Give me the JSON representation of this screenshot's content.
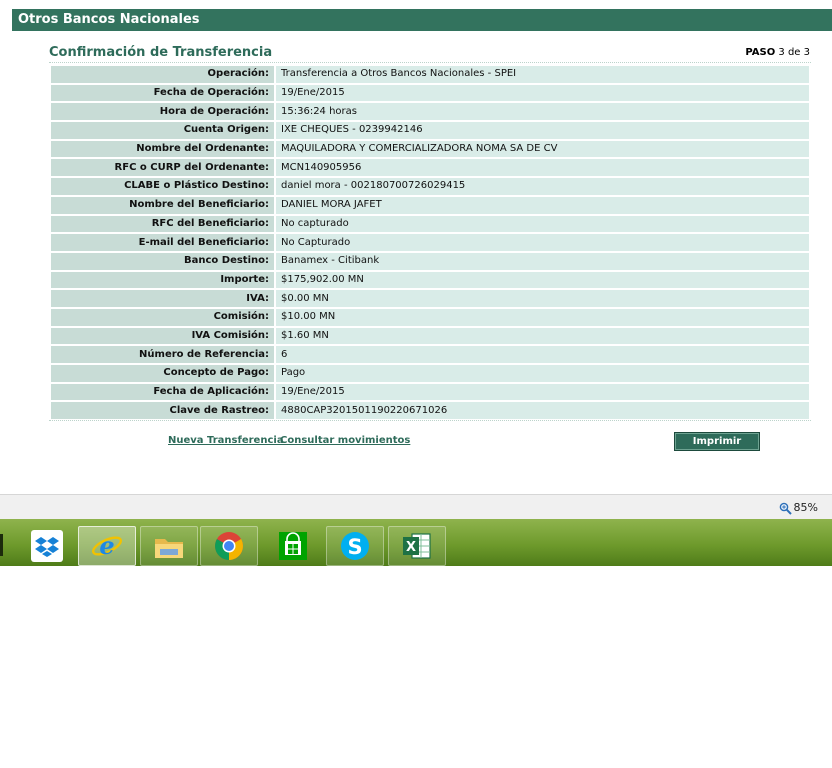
{
  "header": {
    "title": "Otros Bancos Nacionales"
  },
  "form": {
    "title": "Confirmación de Transferencia",
    "step_label": "PASO",
    "step_value": "3 de 3"
  },
  "details": [
    {
      "label": "Operación:",
      "value": "Transferencia a Otros Bancos Nacionales - SPEI"
    },
    {
      "label": "Fecha de Operación:",
      "value": "19/Ene/2015"
    },
    {
      "label": "Hora de Operación:",
      "value": "15:36:24 horas"
    },
    {
      "label": "Cuenta Origen:",
      "value": "IXE CHEQUES - 0239942146"
    },
    {
      "label": "Nombre del Ordenante:",
      "value": "MAQUILADORA Y COMERCIALIZADORA NOMA SA DE CV"
    },
    {
      "label": "RFC o CURP del Ordenante:",
      "value": "MCN140905956"
    },
    {
      "label": "CLABE o Plástico Destino:",
      "value": "daniel mora - 002180700726029415"
    },
    {
      "label": "Nombre del Beneficiario:",
      "value": "DANIEL MORA JAFET"
    },
    {
      "label": "RFC del Beneficiario:",
      "value": "No capturado"
    },
    {
      "label": "E-mail del Beneficiario:",
      "value": "No Capturado"
    },
    {
      "label": "Banco Destino:",
      "value": "Banamex - Citibank"
    },
    {
      "label": "Importe:",
      "value": "$175,902.00 MN"
    },
    {
      "label": "IVA:",
      "value": "$0.00 MN"
    },
    {
      "label": "Comisión:",
      "value": "$10.00 MN"
    },
    {
      "label": "IVA Comisión:",
      "value": "$1.60 MN"
    },
    {
      "label": "Número de Referencia:",
      "value": "6"
    },
    {
      "label": "Concepto de Pago:",
      "value": "Pago"
    },
    {
      "label": "Fecha de Aplicación:",
      "value": "19/Ene/2015"
    },
    {
      "label": "Clave de Rastreo:",
      "value": "4880CAP3201501190220671026"
    }
  ],
  "actions": {
    "new_transfer": "Nueva Transferencia",
    "view_movements": "Consultar movimientos",
    "print": "Imprimir"
  },
  "status_bar": {
    "zoom": "85%",
    "zoom_icon": "zoom-magnifier-icon"
  },
  "taskbar": {
    "apps": [
      {
        "name": "dropbox",
        "icon": "dropbox-icon"
      },
      {
        "name": "internet-explorer",
        "icon": "internet-explorer-icon",
        "active": true
      },
      {
        "name": "file-explorer",
        "icon": "folder-icon"
      },
      {
        "name": "chrome",
        "icon": "chrome-icon"
      },
      {
        "name": "windows-store",
        "icon": "store-icon"
      },
      {
        "name": "skype",
        "icon": "skype-icon"
      },
      {
        "name": "excel",
        "icon": "excel-icon"
      }
    ]
  },
  "colors": {
    "header": "#33735e",
    "label_cell": "#c8dcd6",
    "value_cell": "#d9ece8",
    "accent": "#2e6b5a",
    "taskbar": "#6e9a2c"
  }
}
